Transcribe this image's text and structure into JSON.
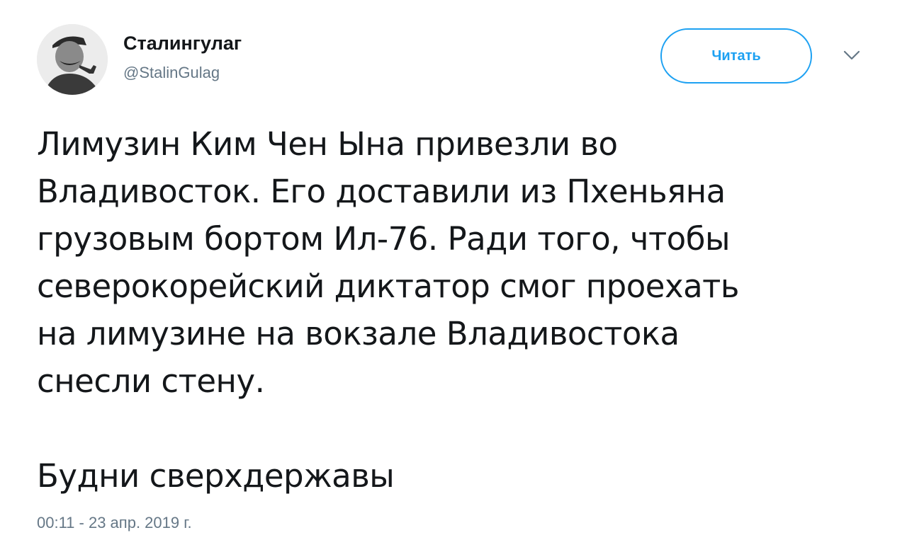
{
  "user": {
    "display_name": "Сталингулаг",
    "handle": "@StalinGulag",
    "avatar_icon": "portrait-avatar"
  },
  "actions": {
    "follow_label": "Читать",
    "caret_icon": "chevron-down-icon"
  },
  "tweet": {
    "text": "Лимузин Ким Чен Ына привезли во\nВладивосток. Его доставили из Пхеньяна\nгрузовым бортом Ил-76. Ради того, чтобы\nсеверокорейский диктатор смог проехать\nна лимузине на вокзале Владивостока\nснесли стену.\n\nБудни сверхдержавы",
    "timestamp": "00:11 - 23 апр. 2019 г."
  },
  "colors": {
    "accent": "#1da1f2",
    "text": "#14171a",
    "secondary": "#657786"
  }
}
